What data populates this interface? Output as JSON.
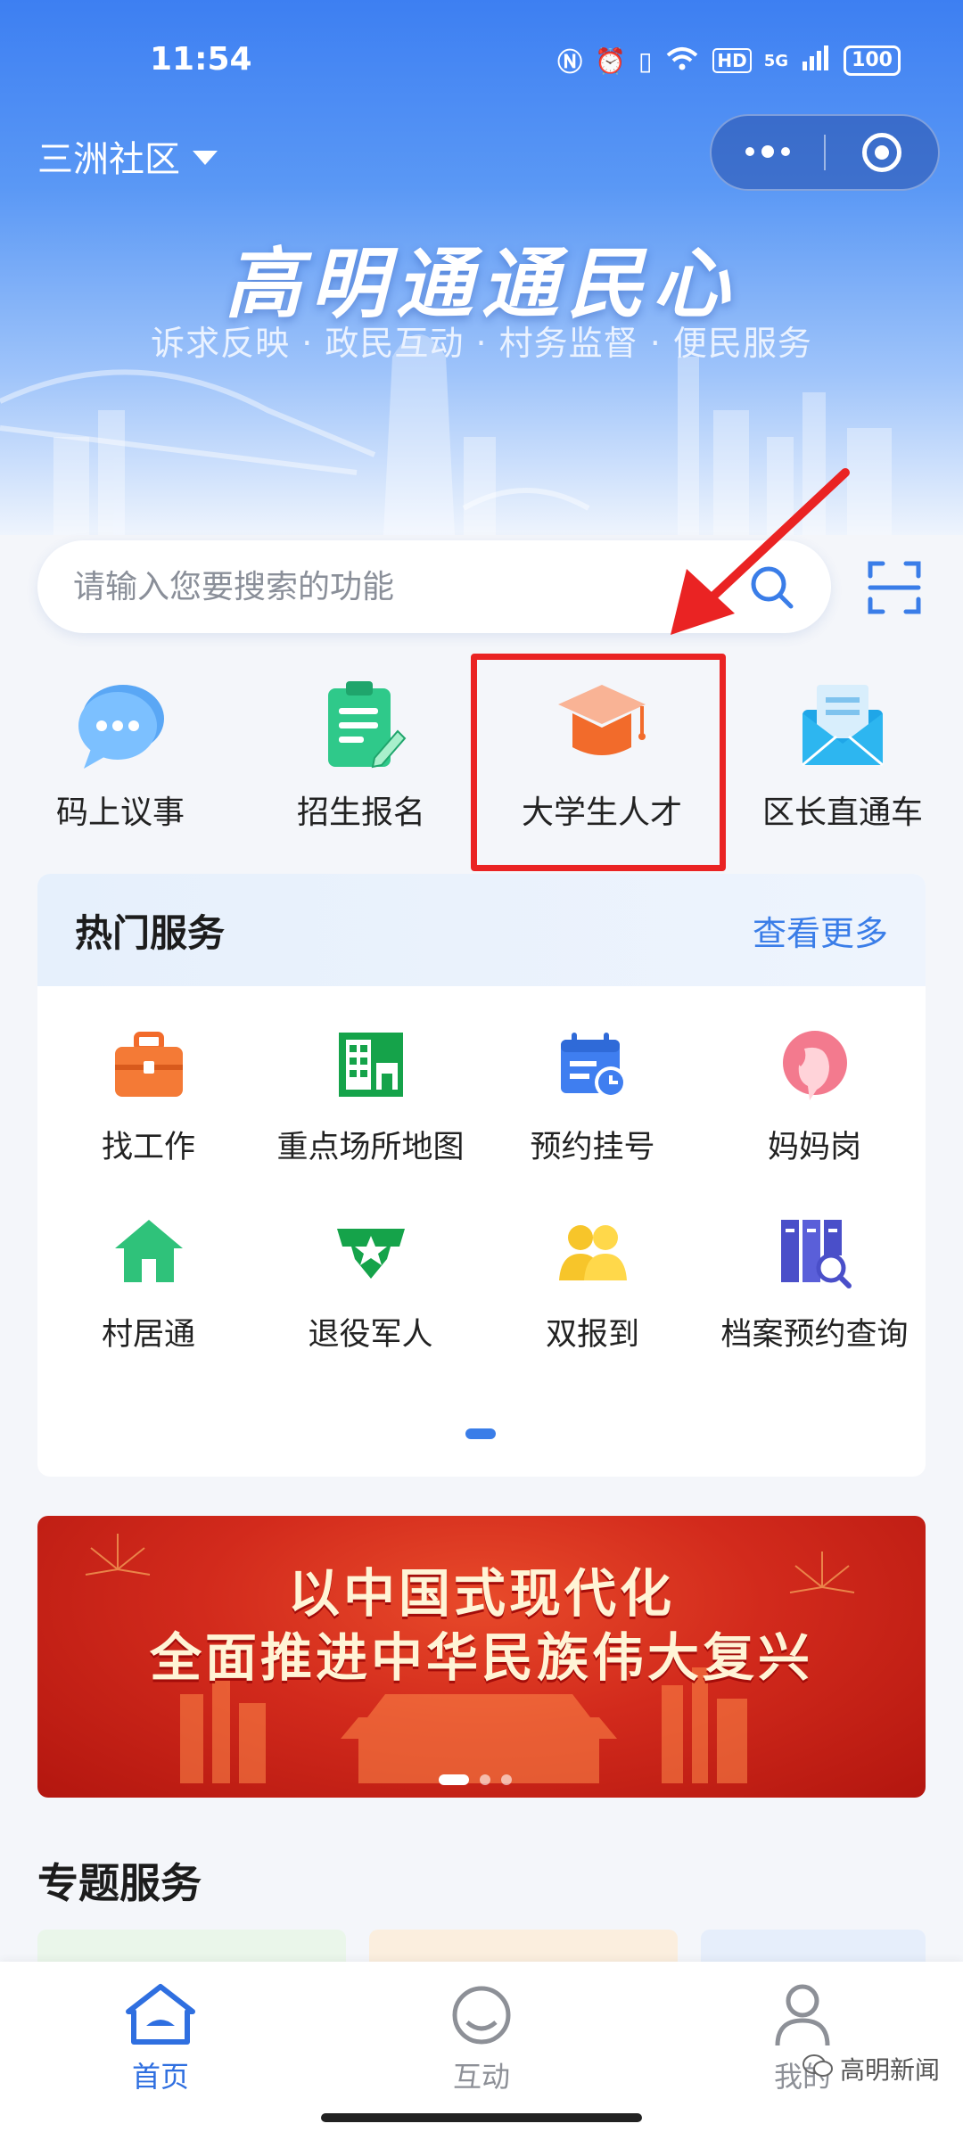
{
  "status_bar": {
    "time": "11:54",
    "network": "5G",
    "hd": "HD",
    "battery": "100"
  },
  "header": {
    "community": "三洲社区",
    "slogan": "高明通通民心",
    "subtitle": "诉求反映 · 政民互动 · 村务监督 · 便民服务"
  },
  "search": {
    "placeholder": "请输入您要搜索的功能"
  },
  "quick_entries": [
    {
      "label": "码上议事",
      "icon": "chat-bubble-icon"
    },
    {
      "label": "招生报名",
      "icon": "clipboard-pen-icon"
    },
    {
      "label": "大学生人才",
      "icon": "graduation-cap-icon",
      "highlighted": true
    },
    {
      "label": "区长直通车",
      "icon": "envelope-icon"
    }
  ],
  "hot_services": {
    "title": "热门服务",
    "more": "查看更多",
    "items": [
      {
        "label": "找工作",
        "icon": "briefcase-icon"
      },
      {
        "label": "重点场所地图",
        "icon": "building-map-icon"
      },
      {
        "label": "预约挂号",
        "icon": "calendar-clock-icon"
      },
      {
        "label": "妈妈岗",
        "icon": "woman-profile-icon"
      },
      {
        "label": "村居通",
        "icon": "house-icon"
      },
      {
        "label": "退役军人",
        "icon": "star-badge-icon"
      },
      {
        "label": "双报到",
        "icon": "people-group-icon"
      },
      {
        "label": "档案预约查询",
        "icon": "archive-search-icon"
      }
    ]
  },
  "banner": {
    "line1": "以中国式现代化",
    "line2": "全面推进中华民族伟大复兴",
    "active_slide": 1,
    "slide_count": 3
  },
  "topic_section": {
    "title": "专题服务"
  },
  "tabbar": [
    {
      "label": "首页",
      "icon": "home-icon",
      "active": true
    },
    {
      "label": "互动",
      "icon": "interaction-icon",
      "active": false
    },
    {
      "label": "我的",
      "icon": "user-icon",
      "active": false
    }
  ],
  "watermark": "高明新闻",
  "colors": {
    "primary": "#3a7de8",
    "highlight_border": "#ea2323",
    "banner_red": "#d22a1c"
  }
}
